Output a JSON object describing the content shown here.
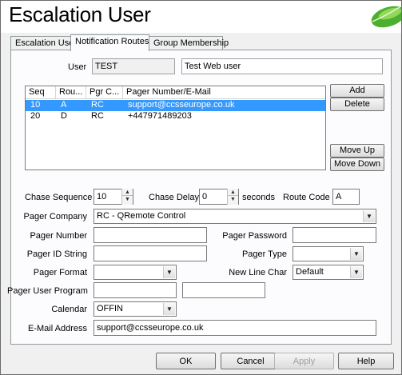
{
  "window": {
    "title": "Escalation User"
  },
  "tabs": [
    {
      "label": "Escalation User",
      "active": false
    },
    {
      "label": "Notification Routes",
      "active": true
    },
    {
      "label": "Group Membership",
      "active": false
    }
  ],
  "user": {
    "label": "User",
    "id": "TEST",
    "name": "Test Web user"
  },
  "routes": {
    "columns": [
      "Seq",
      "Rou...",
      "Pgr C...",
      "Pager Number/E-Mail"
    ],
    "rows": [
      {
        "seq": "10",
        "route": "A",
        "pager_company": "RC",
        "number": "support@ccsseurope.co.uk",
        "selected": true
      },
      {
        "seq": "20",
        "route": "D",
        "pager_company": "RC",
        "number": "+447971489203",
        "selected": false
      }
    ],
    "buttons": {
      "add": "Add",
      "delete": "Delete",
      "move_up": "Move Up",
      "move_down": "Move Down"
    }
  },
  "form": {
    "chase_sequence_label": "Chase Sequence",
    "chase_sequence": "10",
    "chase_delay_label": "Chase Delay",
    "chase_delay": "0",
    "seconds_label": "seconds",
    "route_code_label": "Route Code",
    "route_code": "A",
    "pager_company_label": "Pager Company",
    "pager_company": "RC - QRemote Control",
    "pager_number_label": "Pager Number",
    "pager_number": "",
    "pager_password_label": "Pager Password",
    "pager_password": "",
    "pager_id_string_label": "Pager ID String",
    "pager_id_string": "",
    "pager_type_label": "Pager Type",
    "pager_type": "",
    "pager_format_label": "Pager Format",
    "pager_format": "",
    "new_line_char_label": "New Line Char",
    "new_line_char": "Default",
    "pager_user_program_label": "Pager User Program",
    "pager_user_program": "",
    "pager_user_program_2": "",
    "calendar_label": "Calendar",
    "calendar": "OFFIN",
    "email_address_label": "E-Mail Address",
    "email_address": "support@ccsseurope.co.uk"
  },
  "dialog_buttons": {
    "ok": "OK",
    "cancel": "Cancel",
    "apply": "Apply",
    "help": "Help"
  },
  "colors": {
    "selection": "#3399ff",
    "panel": "#fcfcfe",
    "window": "#f0f0f0"
  }
}
